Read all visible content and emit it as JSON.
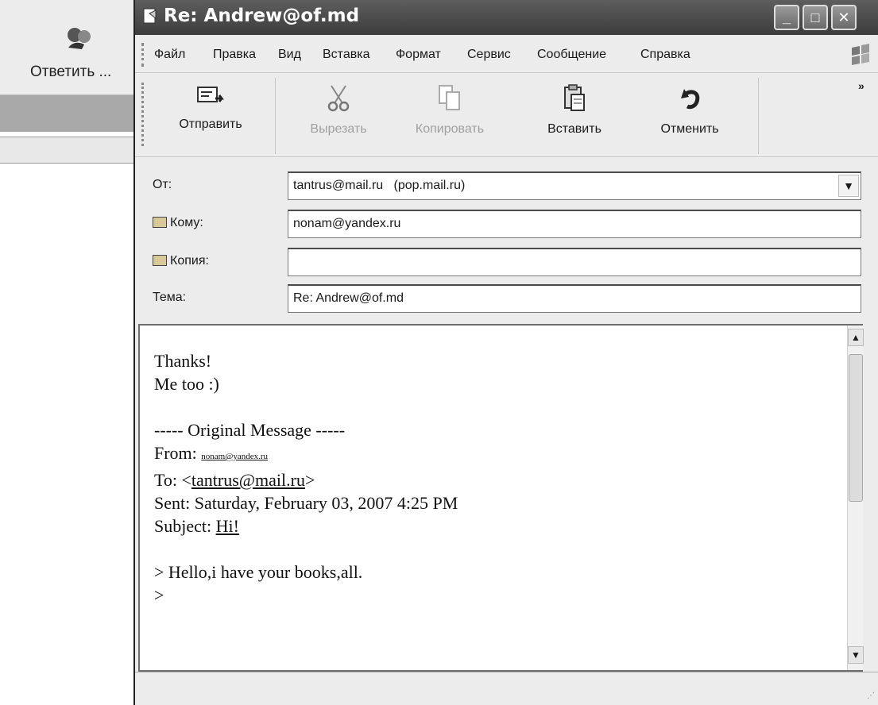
{
  "background": {
    "reply_label": "Ответить ..."
  },
  "window": {
    "title": "Re: Andrew@of.md"
  },
  "menu": [
    "Файл",
    "Правка",
    "Вид",
    "Вставка",
    "Формат",
    "Сервис",
    "Сообщение",
    "Справка"
  ],
  "toolbar": {
    "send": "Отправить",
    "cut": "Вырезать",
    "copy": "Копировать",
    "paste": "Вставить",
    "undo": "Отменить"
  },
  "headers": {
    "from_label": "От:",
    "from_value": "tantrus@mail.ru   (pop.mail.ru)",
    "to_label": "Кому:",
    "to_value": "nonam@yandex.ru",
    "cc_label": "Копия:",
    "cc_value": "",
    "subject_label": "Тема:",
    "subject_value": "Re: Andrew@of.md"
  },
  "body": {
    "line1": "Thanks!",
    "line2": "Me too :)",
    "line3": "----- Original Message -----",
    "from_prefix": "From: ",
    "from_link": "nonam@yandex.ru",
    "to_prefix": "To: <",
    "to_link": "tantrus@mail.ru",
    "to_suffix": ">",
    "sent": "Sent: Saturday, February 03, 2007 4:25 PM",
    "subject_prefix": "Subject: ",
    "subject_link": "Hi!",
    "quote1": "> Hello,i have your books,all.",
    "quote2": ">"
  }
}
